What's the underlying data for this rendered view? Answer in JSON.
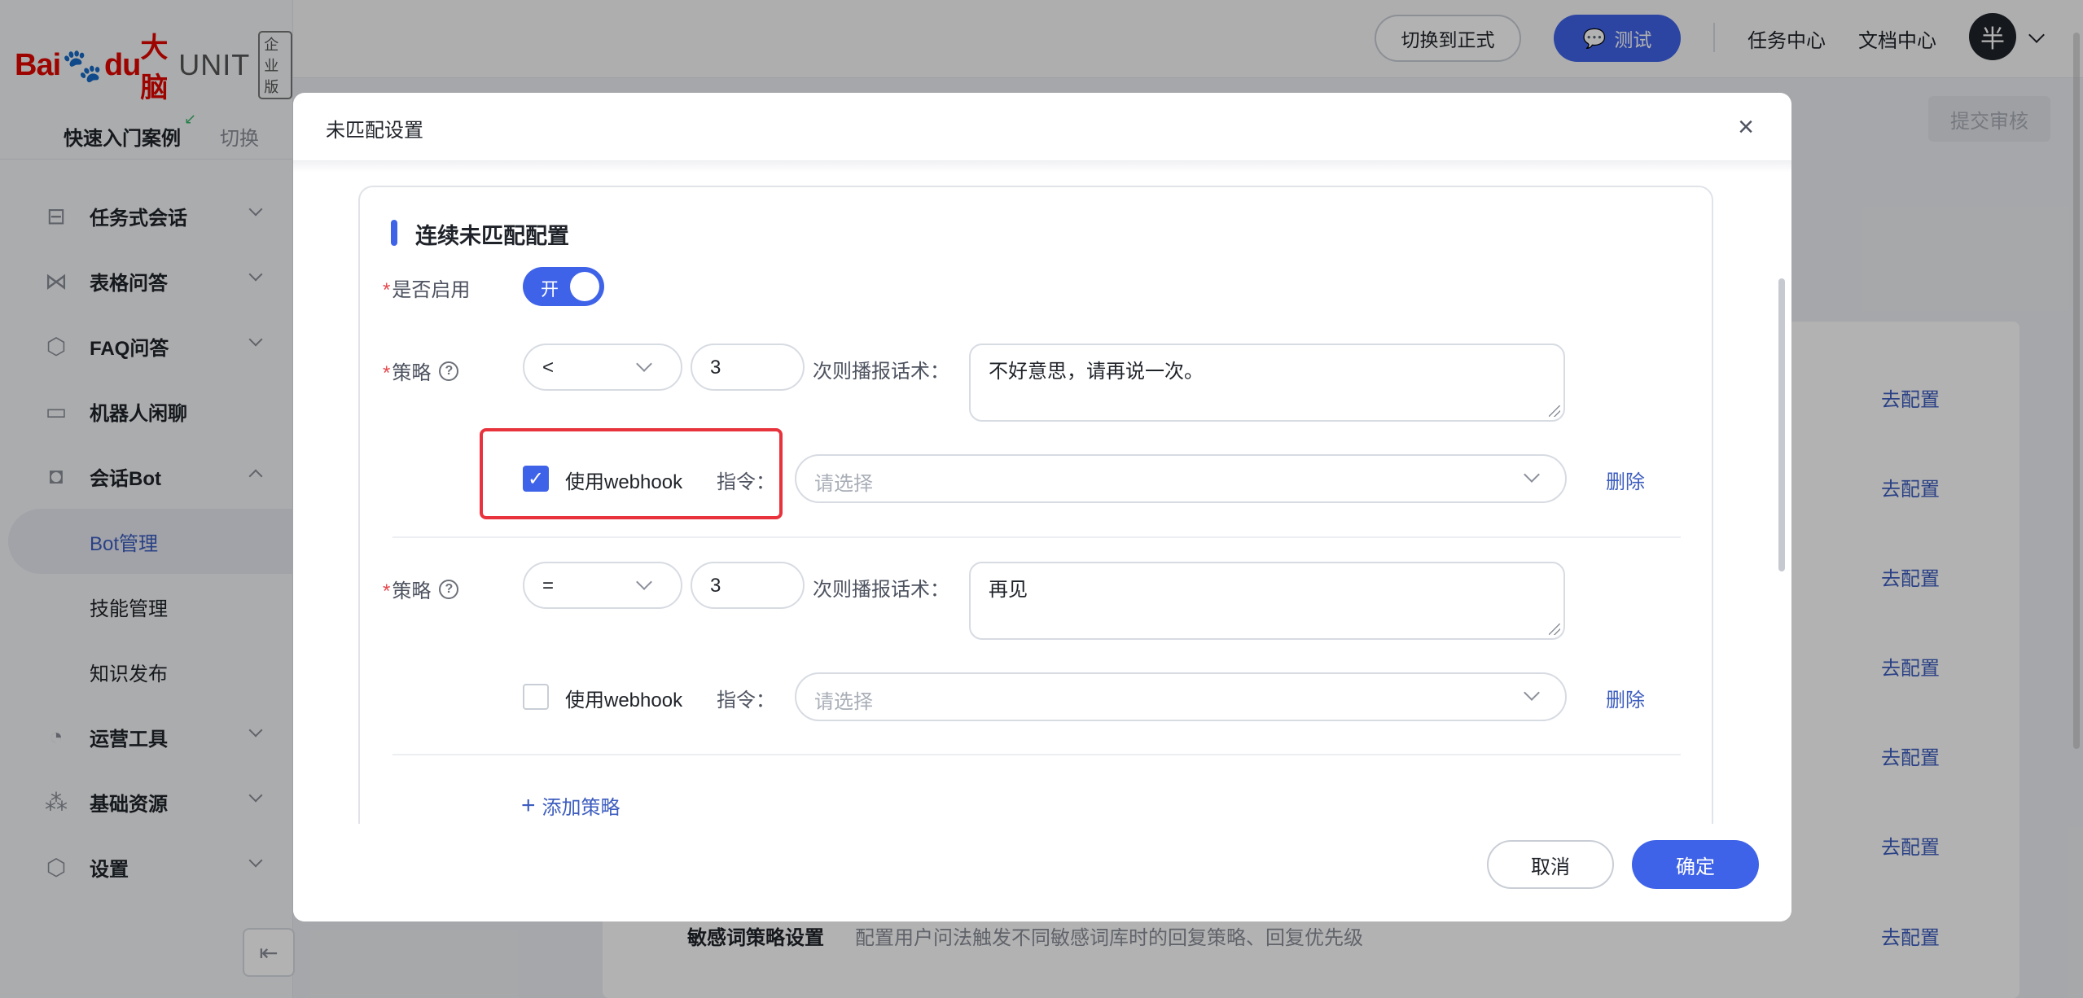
{
  "logo": {
    "baidu": "Bai",
    "paw": "🐾",
    "du": "du",
    "dana": "大脑",
    "unit": "UNIT",
    "edition": "企业版"
  },
  "quick_tabs": {
    "tab1": "快速入门案例",
    "tab2": "切换"
  },
  "sidebar": {
    "menu": [
      {
        "label": "任务式会话",
        "icon": "flow-icon",
        "expanded": false
      },
      {
        "label": "表格问答",
        "icon": "graph-icon",
        "expanded": false
      },
      {
        "label": "FAQ问答",
        "icon": "question-hex-icon",
        "expanded": false
      },
      {
        "label": "机器人闲聊",
        "icon": "chat-icon",
        "expanded": false
      },
      {
        "label": "会话Bot",
        "icon": "bot-icon",
        "expanded": true
      }
    ],
    "bot_sub": [
      {
        "label": "Bot管理",
        "active": true
      },
      {
        "label": "技能管理",
        "active": false
      },
      {
        "label": "知识发布",
        "active": false
      }
    ],
    "menu_bottom": [
      {
        "label": "运营工具",
        "icon": "clock-icon"
      },
      {
        "label": "基础资源",
        "icon": "cluster-icon"
      },
      {
        "label": "设置",
        "icon": "gear-hex-icon"
      }
    ]
  },
  "topbar": {
    "switch_label": "切换到正式",
    "test_label": "测试",
    "task_center": "任务中心",
    "doc_center": "文档中心",
    "avatar_text": "半"
  },
  "background": {
    "submit_review": "提交审核",
    "config_link": "去配置",
    "row_title": "敏感词策略设置",
    "row_desc": "配置用户问法触发不同敏感词库时的回复策略、回复优先级"
  },
  "modal": {
    "title": "未匹配设置",
    "section_title": "连续未匹配配置",
    "enable_label": "是否启用",
    "toggle_text": "开",
    "toggle_on": true,
    "strategy_label": "策略",
    "times_label": "次则播报话术：",
    "webhook_label": "使用webhook",
    "command_label": "指令：",
    "command_placeholder": "请选择",
    "delete_label": "删除",
    "add_strategy": "添加策略",
    "cancel": "取消",
    "confirm": "确定",
    "strategies": [
      {
        "operator": "<",
        "count": "3",
        "reply": "不好意思，请再说一次。",
        "use_webhook": true
      },
      {
        "operator": "=",
        "count": "3",
        "reply": "再见",
        "use_webhook": false
      }
    ]
  }
}
